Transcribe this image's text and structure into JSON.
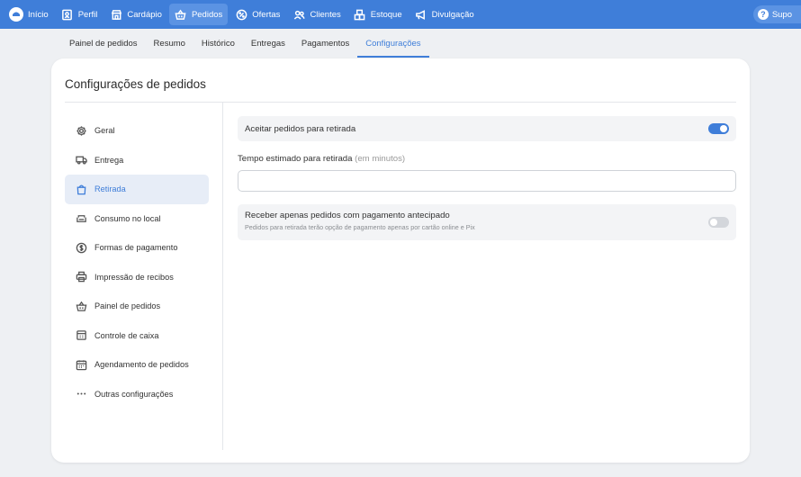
{
  "topnav": {
    "items": [
      {
        "label": "Início",
        "icon": "logo-icon"
      },
      {
        "label": "Perfil",
        "icon": "id-card-icon"
      },
      {
        "label": "Cardápio",
        "icon": "store-icon"
      },
      {
        "label": "Pedidos",
        "icon": "basket-icon",
        "active": true
      },
      {
        "label": "Ofertas",
        "icon": "discount-icon"
      },
      {
        "label": "Clientes",
        "icon": "users-icon"
      },
      {
        "label": "Estoque",
        "icon": "boxes-icon"
      },
      {
        "label": "Divulgação",
        "icon": "megaphone-icon"
      }
    ],
    "support_label": "Supo",
    "support_icon": "?"
  },
  "subtabs": [
    "Painel de pedidos",
    "Resumo",
    "Histórico",
    "Entregas",
    "Pagamentos",
    "Configurações"
  ],
  "active_subtab": "Configurações",
  "card": {
    "title": "Configurações de pedidos"
  },
  "sidebar": {
    "items": [
      {
        "label": "Geral",
        "icon": "gear-icon"
      },
      {
        "label": "Entrega",
        "icon": "truck-icon"
      },
      {
        "label": "Retirada",
        "icon": "bag-icon",
        "active": true
      },
      {
        "label": "Consumo no local",
        "icon": "sofa-icon"
      },
      {
        "label": "Formas de pagamento",
        "icon": "dollar-icon"
      },
      {
        "label": "Impressão de recibos",
        "icon": "printer-icon"
      },
      {
        "label": "Painel de pedidos",
        "icon": "basket-icon"
      },
      {
        "label": "Controle de caixa",
        "icon": "cash-register-icon"
      },
      {
        "label": "Agendamento de pedidos",
        "icon": "calendar-icon"
      },
      {
        "label": "Outras configurações",
        "icon": "dots-icon"
      }
    ]
  },
  "content": {
    "accept_pickup": {
      "label": "Aceitar pedidos para retirada",
      "enabled": true
    },
    "estimated_time": {
      "label": "Tempo estimado para retirada",
      "hint": "(em minutos)",
      "value": ""
    },
    "prepaid_only": {
      "label": "Receber apenas pedidos com pagamento antecipado",
      "description": "Pedidos para retirada terão opção de pagamento apenas por cartão online e Pix",
      "enabled": false
    }
  },
  "colors": {
    "accent": "#3f7ed9",
    "background": "#eef0f3",
    "active_bg": "#e7edf7"
  }
}
